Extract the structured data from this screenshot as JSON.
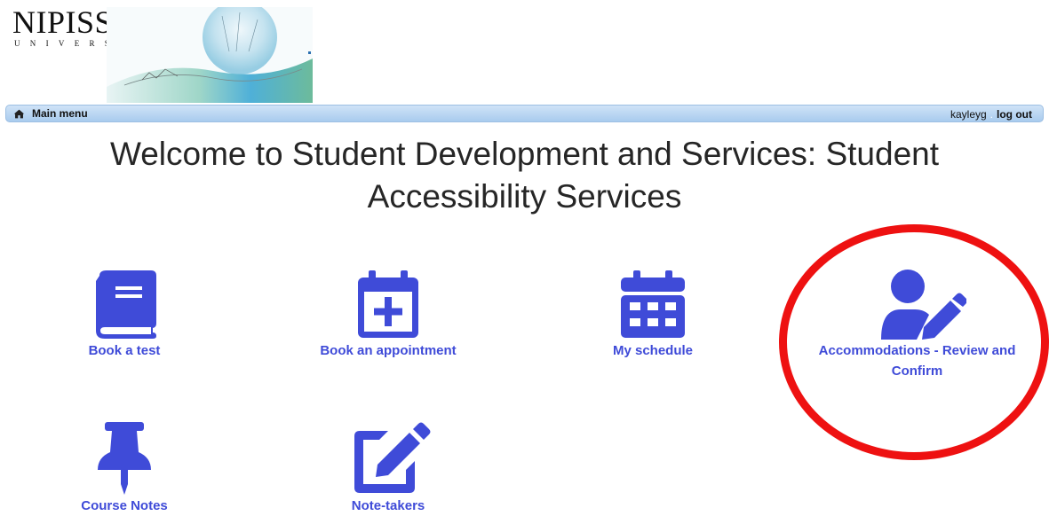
{
  "logo": {
    "name": "NIPISSING",
    "sub": "UNIVERSITY"
  },
  "navbar": {
    "main_menu": "Main menu",
    "username": "kayleyg",
    "separator": ".",
    "logout": "log out"
  },
  "page_title": "Welcome to Student Development and Services: Student Accessibility Services",
  "tiles": [
    {
      "label": "Book a test",
      "icon": "book-icon"
    },
    {
      "label": "Book an appointment",
      "icon": "calendar-plus-icon"
    },
    {
      "label": "My schedule",
      "icon": "calendar-icon"
    },
    {
      "label": "Accommodations - Review and Confirm",
      "icon": "user-edit-icon"
    },
    {
      "label": "Course Notes",
      "icon": "pushpin-icon"
    },
    {
      "label": "Note-takers",
      "icon": "edit-icon"
    }
  ],
  "colors": {
    "accent": "#3f4bd8",
    "highlight": "#ee1111",
    "navbar": "#b8d5f2"
  }
}
